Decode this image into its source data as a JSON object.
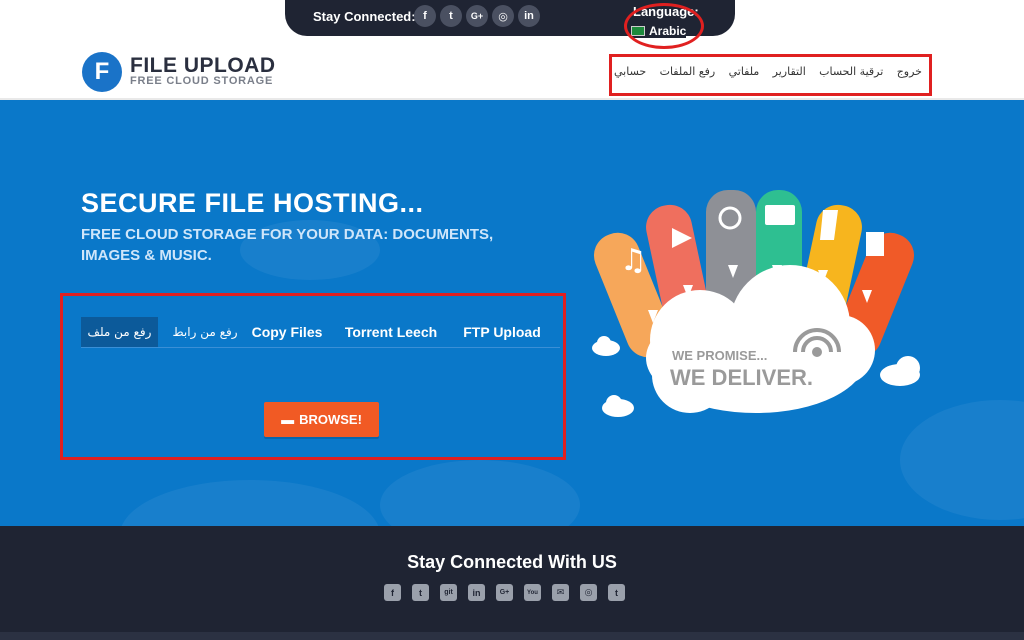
{
  "topbar": {
    "stay_connected": "Stay Connected:",
    "social": [
      {
        "icon": "facebook-icon",
        "glyph": "f"
      },
      {
        "icon": "twitter-icon",
        "glyph": "t"
      },
      {
        "icon": "google-plus-icon",
        "glyph": "G+"
      },
      {
        "icon": "instagram-icon",
        "glyph": "◎"
      },
      {
        "icon": "linkedin-icon",
        "glyph": "in"
      }
    ],
    "language_label": "Language:",
    "language_value": "Arabic"
  },
  "header": {
    "logo_letter": "F",
    "logo_title": "FILE UPLOAD",
    "logo_subtitle": "FREE CLOUD STORAGE",
    "nav": [
      "خروج",
      "ترقية الحساب",
      "التقارير",
      "ملفاتي",
      "رفع الملفات",
      "حسابي"
    ]
  },
  "hero": {
    "title": "SECURE FILE HOSTING...",
    "subtitle": "FREE CLOUD STORAGE FOR YOUR DATA: DOCUMENTS, IMAGES & MUSIC.",
    "tabs": [
      "رفع من ملف",
      "رفع من رابط",
      "Copy Files",
      "Torrent Leech",
      "FTP Upload"
    ],
    "browse": "BROWSE!",
    "promise_line1": "WE PROMISE...",
    "promise_line2": "WE DELIVER."
  },
  "footer": {
    "title": "Stay Connected With US",
    "icons": [
      {
        "icon": "facebook-icon",
        "glyph": "f"
      },
      {
        "icon": "twitter-icon",
        "glyph": "t"
      },
      {
        "icon": "git-icon",
        "glyph": "git"
      },
      {
        "icon": "linkedin-icon",
        "glyph": "in"
      },
      {
        "icon": "google-plus-icon",
        "glyph": "G+"
      },
      {
        "icon": "youtube-icon",
        "glyph": "You"
      },
      {
        "icon": "email-icon",
        "glyph": "✉"
      },
      {
        "icon": "instagram-icon",
        "glyph": "◎"
      },
      {
        "icon": "tumblr-icon",
        "glyph": "t"
      }
    ]
  },
  "colors": {
    "accent": "#0a78c9",
    "dark": "#1f2433",
    "browse": "#f15a24",
    "highlight": "#e02020"
  }
}
